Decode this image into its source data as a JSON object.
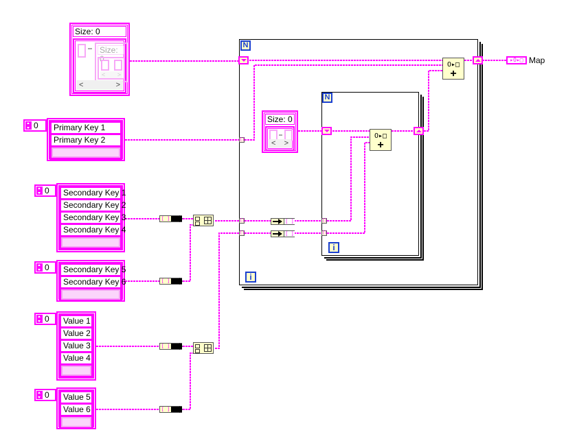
{
  "diagram": {
    "type": "LabVIEW block diagram",
    "wire_color": "#ff00ff",
    "loop_terminal_color": "#1a3fd0",
    "node_fill": "#ffffcc"
  },
  "map_constant_top": {
    "size_label": "Size: 0",
    "inner_size_label": "Size: 0",
    "nav_left": "<",
    "nav_right": ">",
    "inner_nav_left": "<",
    "inner_nav_right": ">"
  },
  "primary_keys": {
    "index": "0",
    "items": [
      "Primary Key 1",
      "Primary Key 2"
    ]
  },
  "secondary_keys_a": {
    "index": "0",
    "items": [
      "Secondary Key 1",
      "Secondary Key 2",
      "Secondary Key 3",
      "Secondary Key 4"
    ]
  },
  "secondary_keys_b": {
    "index": "0",
    "items": [
      "Secondary Key 5",
      "Secondary Key 6"
    ]
  },
  "values_a": {
    "index": "0",
    "items": [
      "Value 1",
      "Value 2",
      "Value 3",
      "Value 4"
    ]
  },
  "values_b": {
    "index": "0",
    "items": [
      "Value 5",
      "Value 6"
    ]
  },
  "inner_map_constant": {
    "size_label": "Size: 0",
    "nav_left": "<",
    "nav_right": ">"
  },
  "outer_loop": {
    "count_terminal": "N",
    "iteration_terminal": "i"
  },
  "inner_loop": {
    "count_terminal": "N",
    "iteration_terminal": "i"
  },
  "nodes": {
    "insert_glyph_top": "O▸□",
    "insert_glyph_plus": "+",
    "tunnel_glyph": "[]",
    "variant_glyph": "[ ]"
  },
  "indicator": {
    "label": "Map",
    "glyph": "▸O▸□"
  }
}
